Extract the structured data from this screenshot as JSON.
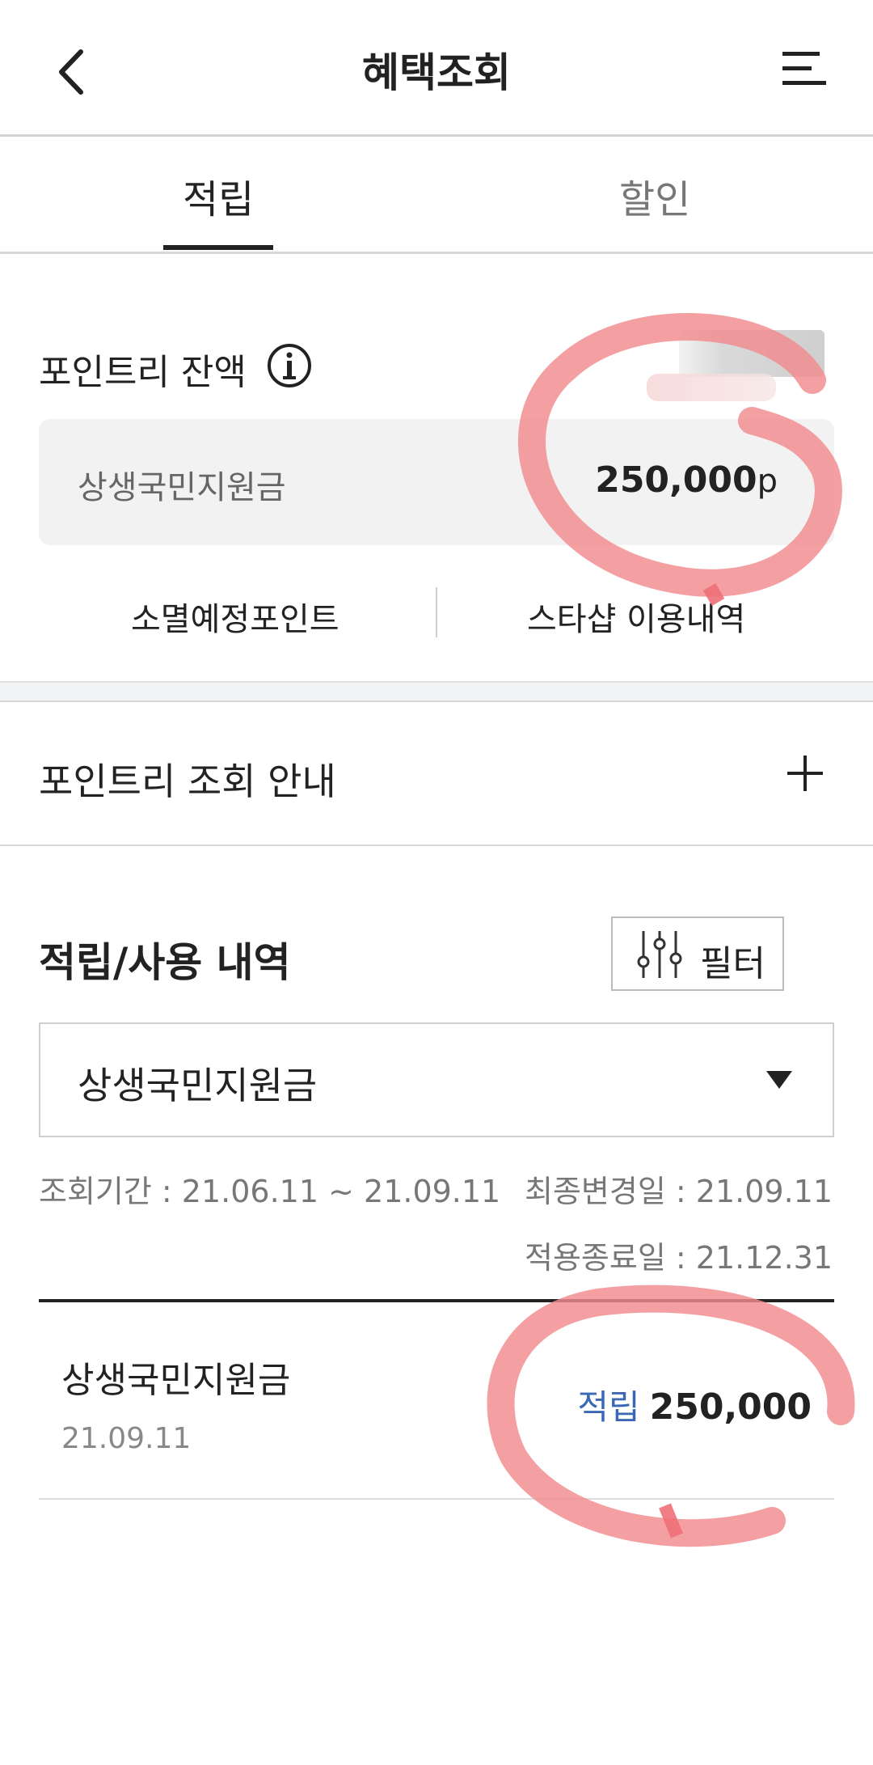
{
  "header": {
    "title": "혜택조회",
    "back_icon": "chevron-left-icon",
    "menu_icon": "menu-icon"
  },
  "tabs": [
    {
      "label": "적립",
      "active": true
    },
    {
      "label": "할인",
      "active": false
    }
  ],
  "balance": {
    "title": "포인트리 잔액",
    "info_icon": "info-icon",
    "item_name": "상생국민지원금",
    "amount": "250,000",
    "unit": "p",
    "links": {
      "expire": "소멸예정포인트",
      "history": "스타샵 이용내역"
    }
  },
  "guide": {
    "label": "포인트리 조회 안내",
    "toggle_icon": "plus-icon"
  },
  "history": {
    "title": "적립/사용 내역",
    "filter_label": "필터",
    "filter_icon": "sliders-icon",
    "select_value": "상생국민지원금",
    "period": "조회기간 : 21.06.11 ~ 21.09.11",
    "last_changed": "최종변경일 : 21.09.11",
    "end_date": "적용종료일 : 21.12.31",
    "rows": [
      {
        "name": "상생국민지원금",
        "date": "21.09.11",
        "type": "적립",
        "amount": "250,000"
      }
    ]
  },
  "colors": {
    "accent_blue": "#3a68b4",
    "annotation_pink": "#f28b8e",
    "panel_gray": "#f2f2f2"
  }
}
